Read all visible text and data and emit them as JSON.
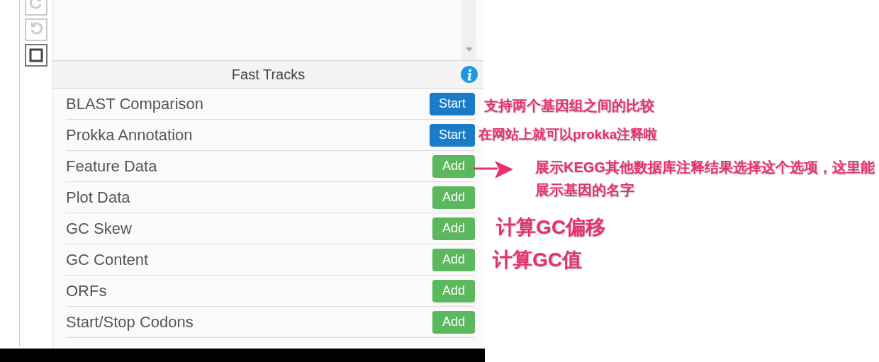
{
  "toolbar": [
    {
      "kind": "redo",
      "disabled": true
    },
    {
      "kind": "undo",
      "disabled": true
    },
    {
      "kind": "stop",
      "disabled": false
    }
  ],
  "fast_tracks": {
    "title": "Fast Tracks",
    "items": [
      {
        "label": "BLAST Comparison",
        "kind": "start",
        "button": "Start"
      },
      {
        "label": "Prokka Annotation",
        "kind": "start",
        "button": "Start"
      },
      {
        "label": "Feature Data",
        "kind": "add",
        "button": "Add"
      },
      {
        "label": "Plot Data",
        "kind": "add",
        "button": "Add"
      },
      {
        "label": "GC Skew",
        "kind": "add",
        "button": "Add"
      },
      {
        "label": "GC Content",
        "kind": "add",
        "button": "Add"
      },
      {
        "label": "ORFs",
        "kind": "add",
        "button": "Add"
      },
      {
        "label": "Start/Stop Codons",
        "kind": "add",
        "button": "Add"
      }
    ]
  },
  "annotations": [
    {
      "kind": "note",
      "text": "支持两个基因组之间的比较"
    },
    {
      "kind": "note",
      "text": "在网站上就可以prokka注释啦"
    },
    {
      "kind": "arrow_note",
      "text": "展示KEGG其他数据库注释结果选择这个选项，这里能展示基因的名字"
    },
    {
      "kind": "heading",
      "text": "计算GC偏移"
    },
    {
      "kind": "heading",
      "text": "计算GC值"
    }
  ]
}
